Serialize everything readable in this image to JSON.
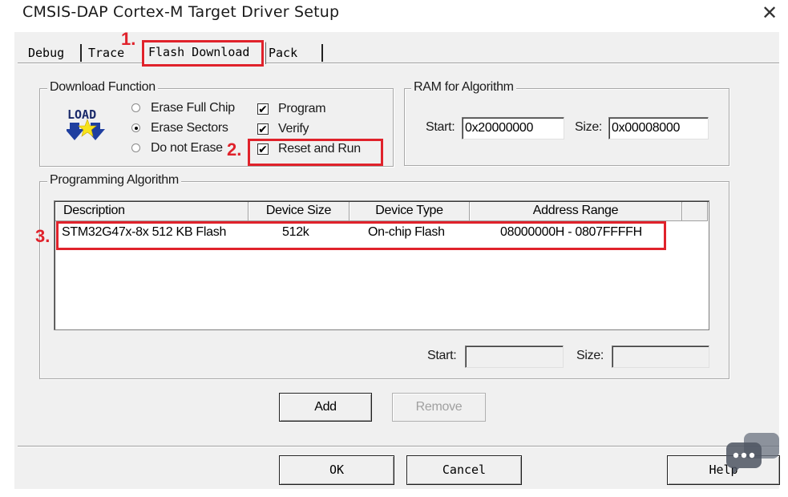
{
  "window": {
    "title": "CMSIS-DAP Cortex-M Target Driver Setup"
  },
  "tabs": [
    {
      "label": "Debug"
    },
    {
      "label": "Trace"
    },
    {
      "label": "Flash Download"
    },
    {
      "label": "Pack"
    }
  ],
  "download_function": {
    "group_title": "Download Function",
    "logo_text": "LOAD",
    "radios": [
      {
        "label": "Erase Full Chip",
        "selected": false
      },
      {
        "label": "Erase Sectors",
        "selected": true
      },
      {
        "label": "Do not Erase",
        "selected": false
      }
    ],
    "checks": [
      {
        "label": "Program",
        "checked": true,
        "mark": "✔"
      },
      {
        "label": "Verify",
        "checked": true,
        "mark": "✔"
      },
      {
        "label": "Reset and Run",
        "checked": true,
        "mark": "✔"
      }
    ]
  },
  "ram": {
    "group_title": "RAM for Algorithm",
    "start_label": "Start:",
    "start_value": "0x20000000",
    "size_label": "Size:",
    "size_value": "0x00008000"
  },
  "algorithm": {
    "group_title": "Programming Algorithm",
    "columns": [
      "Description",
      "Device Size",
      "Device Type",
      "Address Range"
    ],
    "rows": [
      {
        "description": "STM32G47x-8x 512 KB Flash",
        "size": "512k",
        "type": "On-chip Flash",
        "range": "08000000H - 0807FFFFH"
      }
    ],
    "start_label": "Start:",
    "start_value": "",
    "size_label": "Size:",
    "size_value": ""
  },
  "buttons": {
    "add": "Add",
    "remove": "Remove",
    "ok": "OK",
    "cancel": "Cancel",
    "help": "Help"
  },
  "annotations": [
    "1.",
    "2.",
    "3."
  ],
  "colors": {
    "annotation": "#e0222b",
    "dialog_bg": "#f0f0f0"
  }
}
